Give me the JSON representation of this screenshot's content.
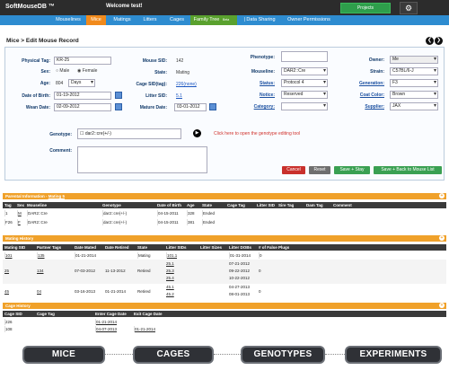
{
  "app": {
    "title": "SoftMouseDB ™",
    "welcome": "Welcome test!",
    "projects_label": "Projects",
    "gear_icon": "gear-icon"
  },
  "nav": [
    "Mouselines",
    "Mice",
    "Matings",
    "Litters",
    "Cages",
    "Family Tree",
    "| Data Sharing",
    "Owner Permissions"
  ],
  "nav_badge": "Beta",
  "page_title": "Mice > Edit Mouse Record",
  "form": {
    "physical_tag_label": "Physical Tag:",
    "physical_tag": "KR-25",
    "sex_label": "Sex:",
    "sex_male": "Male",
    "sex_female": "Female",
    "age_label": "Age:",
    "age": "804",
    "age_unit": "Days",
    "dob_label": "Date of Birth:",
    "dob": "01-19-2012",
    "wean_label": "Wean Date:",
    "wean": "02-09-2012",
    "mouse_sid_label": "Mouse SID:",
    "mouse_sid": "142",
    "state_label": "State:",
    "state": "Mating",
    "cage_sid_label": "Cage SID(tag):",
    "cage_sid": "226(none)",
    "litter_sid_label": "Litter SID:",
    "litter_sid": "5.1",
    "mature_label": "Mature Date:",
    "mature": "03-01-2012",
    "phenotype_label": "Phenotype:",
    "mouseline_label": "Mouseline:",
    "mouseline": "DAR2::Cre",
    "status_label": "Status:",
    "status": "Protocol 4",
    "notice_label": "Notice:",
    "notice": "Reserved",
    "category_label": "Category:",
    "owner_label": "Owner:",
    "owner": "Me",
    "strain_label": "Strain:",
    "strain": "C57BL/6-J",
    "generation_label": "Generation:",
    "generation": "F3",
    "coat_label": "Coat Color:",
    "coat": "Brown",
    "supplier_label": "Supplier:",
    "supplier": "JAX",
    "genotype_label": "Genotype:",
    "genotype": "dar2::cre(+/-)",
    "genotype_hint": "Click here to open the genotype editing tool",
    "comment_label": "Comment:",
    "cancel": "Cancel",
    "reset": "Reset",
    "save_stay": "Save + Stay",
    "save_back": "Save + Back to Mouse List"
  },
  "parent": {
    "title": "Parental Information",
    "title_link": "Mating 5",
    "headers": [
      "Tag",
      "Sex",
      "Mouseline",
      "Genotype",
      "Date of Birth",
      "Age",
      "State",
      "Cage Tag",
      "Litter SID",
      "Sire Tag",
      "Dam Tag",
      "Comment"
    ],
    "rows": [
      [
        "1",
        "M",
        "DAR2::Cre",
        "dar2::cre(+/-)",
        "04-15-2011",
        "328",
        "Ended",
        "",
        "",
        "",
        "",
        ""
      ],
      [
        "F26",
        "F",
        "DAR2::Cre",
        "dar2::cre(+/-)",
        "04-15-2011",
        "381",
        "Ended",
        "",
        "",
        "",
        "",
        ""
      ]
    ]
  },
  "mating": {
    "title": "Mating History",
    "headers": [
      "Mating SID",
      "Partner Tags",
      "Date Mated",
      "Date Retired",
      "State",
      "Litter SIDs",
      "Litter Sizes",
      "Litter DOBs",
      "# of False Plugs"
    ],
    "rows": [
      [
        "101",
        "135",
        "01-21-2014",
        "",
        "Mating",
        [
          "101.1"
        ],
        [
          "",
          ""
        ],
        [
          "01-31-2014"
        ],
        "0"
      ],
      [
        "25",
        "134",
        "07-03-2012",
        "11-13-2012",
        "Retired",
        [
          "25.1",
          "25.3",
          "25.4"
        ],
        [
          "",
          "",
          ""
        ],
        [
          "07-21-2012",
          "09-22-2012",
          "10-22-2012"
        ],
        "0"
      ],
      [
        "45",
        "04",
        "03-16-2013",
        "01-21-2014",
        "Retired",
        [
          "45.1",
          "45.2"
        ],
        [
          "",
          ""
        ],
        [
          "04-27-2013",
          "08-01-2013"
        ],
        "0"
      ]
    ]
  },
  "cage": {
    "title": "Cage History",
    "headers": [
      "Cage SID",
      "Cage Tag",
      "Enter Cage Date",
      "Exit Cage Date"
    ],
    "rows": [
      [
        "226",
        "",
        "01-21-2014",
        ""
      ],
      [
        "108",
        "",
        "04-07-2013",
        "01-21-2014"
      ]
    ]
  },
  "bottom": [
    "MICE",
    "CAGES",
    "GENOTYPES",
    "EXPERIMENTS"
  ]
}
